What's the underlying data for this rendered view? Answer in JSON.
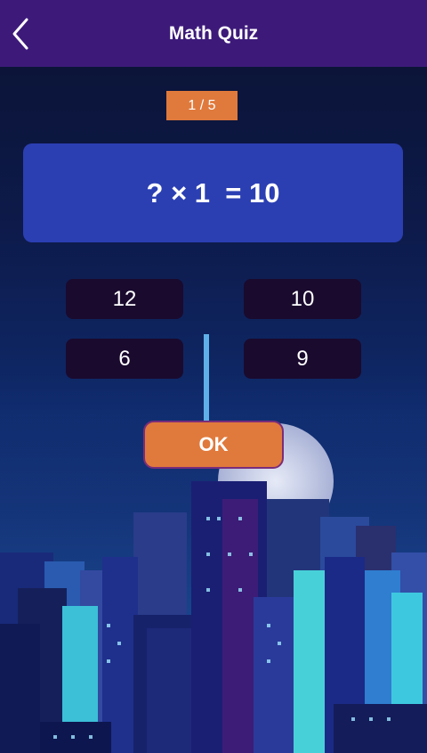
{
  "header": {
    "title": "Math Quiz",
    "back_icon": "chevron-left-icon"
  },
  "quiz": {
    "counter": "1 / 5",
    "question": "? × 1  = 10",
    "options": [
      "12",
      "10",
      "6",
      "9"
    ],
    "ok_label": "OK"
  },
  "colors": {
    "appbar": "#3d1a7a",
    "accent": "#e07a3c",
    "question_bg": "#2b3fb3",
    "option_bg": "#1a0a2e"
  }
}
